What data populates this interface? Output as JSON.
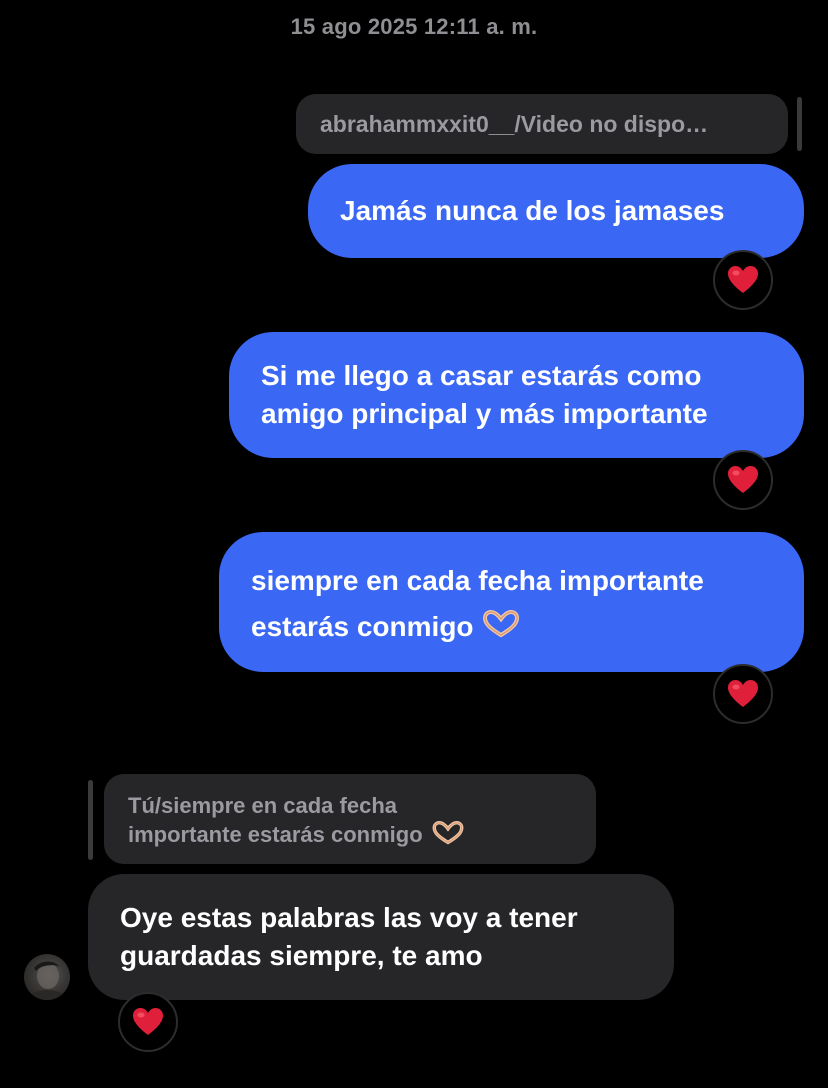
{
  "header": {
    "timestamp": "15 ago 2025 12:11 a. m."
  },
  "colors": {
    "background": "#000000",
    "sent_bubble": "#3a67f4",
    "received_bubble": "#262628",
    "reply_chip": "#262629",
    "timestamp_text": "#8e8e93",
    "reaction_heart": "#e0203a"
  },
  "messages": [
    {
      "direction": "sent",
      "reply_to": "abrahammxxit0__/Video no dispo…",
      "lines": [
        "Jamás nunca de los jamases"
      ],
      "reaction": "red-heart-icon"
    },
    {
      "direction": "sent",
      "lines": [
        "Si me llego a casar estarás como",
        "amigo principal y más importante"
      ],
      "reaction": "red-heart-icon"
    },
    {
      "direction": "sent",
      "lines": [
        "siempre en cada fecha importante",
        "estarás conmigo"
      ],
      "trailing_icon": "heart-hands-icon",
      "reaction": "red-heart-icon"
    },
    {
      "direction": "received",
      "reply_to_lines": [
        "Tú/siempre en cada fecha",
        "importante estarás conmigo"
      ],
      "reply_trailing_icon": "heart-hands-icon",
      "lines": [
        "Oye estas palabras las voy a tener",
        "guardadas siempre, te amo"
      ],
      "reaction": "red-heart-icon",
      "avatar": "sender-avatar"
    }
  ]
}
